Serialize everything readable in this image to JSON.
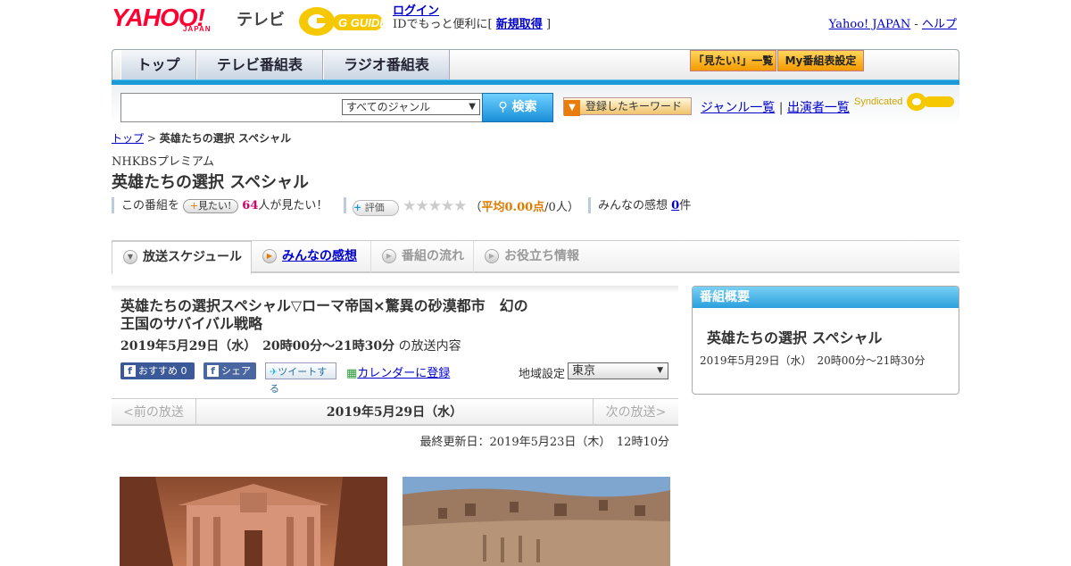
{
  "header": {
    "logo": "YAHOO!",
    "logo_sub": "JAPAN",
    "service": "テレビ",
    "gguide": "G GUIDE",
    "login": "ログイン",
    "login_note_pre": "IDでもっと便利に[",
    "signup": "新規取得",
    "login_note_post": "]",
    "yahoo_japan": "Yahoo! JAPAN",
    "sep": "-",
    "help": "ヘルプ"
  },
  "nav": {
    "tabs": [
      "トップ",
      "テレビ番組表",
      "ラジオ番組表"
    ],
    "mitai_list": "「見たい!」一覧",
    "my_schedule": "My番組表設定"
  },
  "search": {
    "placeholder": "",
    "genre": "すべてのジャンル",
    "button": "検索",
    "keyword_btn": "登録したキーワード",
    "genre_list": "ジャンル一覧",
    "divider": "|",
    "cast_list": "出演者一覧",
    "syndicated": "Syndicated"
  },
  "breadcrumb": {
    "top": "トップ",
    "sep": ">",
    "current": "英雄たちの選択 スペシャル"
  },
  "program": {
    "channel": "NHKBSプレミアム",
    "title": "英雄たちの選択 スペシャル",
    "mitai_pre": "この番組を",
    "mitai_btn": "見たい!",
    "mitai_count": "64",
    "mitai_post": "人が見たい！",
    "rating_btn": "評価",
    "stars": "★★★★★",
    "avg_open": "（",
    "avg_label": "平均0.00点",
    "avg_people": "/0人）",
    "reviews_pre": "みんなの感想",
    "reviews_count": "0",
    "reviews_post": "件"
  },
  "subtabs": [
    "放送スケジュール",
    "みんなの感想",
    "番組の流れ",
    "お役立ち情報"
  ],
  "broadcast": {
    "title": "英雄たちの選択スペシャル▽ローマ帝国×驚異の砂漠都市　幻の王国のサバイバル戦略",
    "time": "2019年5月29日（水）　20時00分～21時30分",
    "time_suffix": "の放送内容",
    "recommend": "おすすめ 0",
    "share": "シェア",
    "tweet": "ツイートする",
    "calendar": "カレンダーに登録",
    "region_label": "地域設定",
    "region": "東京"
  },
  "datebar": {
    "prev": "<前の放送",
    "current": "2019年5月29日（水）",
    "next": "次の放送>"
  },
  "updated": "最終更新日：2019年5月23日（木）　12時10分",
  "side": {
    "heading": "番組概要",
    "title": "英雄たちの選択 スペシャル",
    "time": "2019年5月29日（水）　20時00分～21時30分"
  },
  "colors": {
    "accent_blue": "#1a9bd8",
    "brand_red": "#ff0033",
    "gguide_yellow": "#f5c800"
  }
}
